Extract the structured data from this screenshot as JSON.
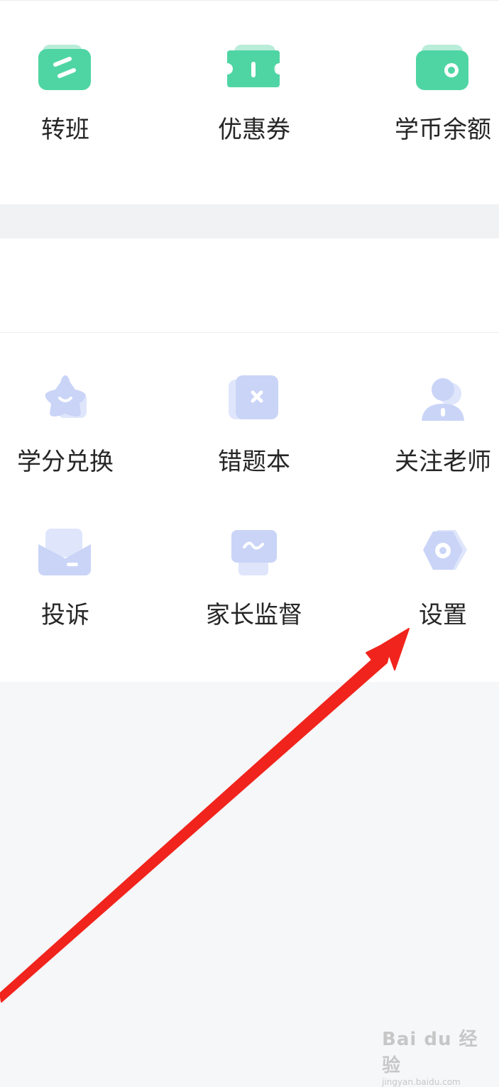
{
  "services_top": [
    {
      "label": "转班",
      "icon": "transfer-class-icon"
    },
    {
      "label": "优惠券",
      "icon": "coupon-icon"
    },
    {
      "label": "学币余额",
      "icon": "wallet-icon"
    }
  ],
  "services_bottom": [
    {
      "label": "学分兑换",
      "icon": "star-icon"
    },
    {
      "label": "错题本",
      "icon": "wrong-questions-icon"
    },
    {
      "label": "关注老师",
      "icon": "teacher-icon"
    },
    {
      "label": "投诉",
      "icon": "envelope-icon"
    },
    {
      "label": "家长监督",
      "icon": "monitor-icon"
    },
    {
      "label": "设置",
      "icon": "settings-gear-icon"
    }
  ],
  "colors": {
    "green_icon": "#4fd5a3",
    "blue_icon": "#c9d4f7",
    "annotation_arrow": "#f0241c",
    "background": "#f6f7f9"
  },
  "watermark": {
    "brand": "Bai du 经验",
    "url": "jingyan.baidu.com"
  }
}
